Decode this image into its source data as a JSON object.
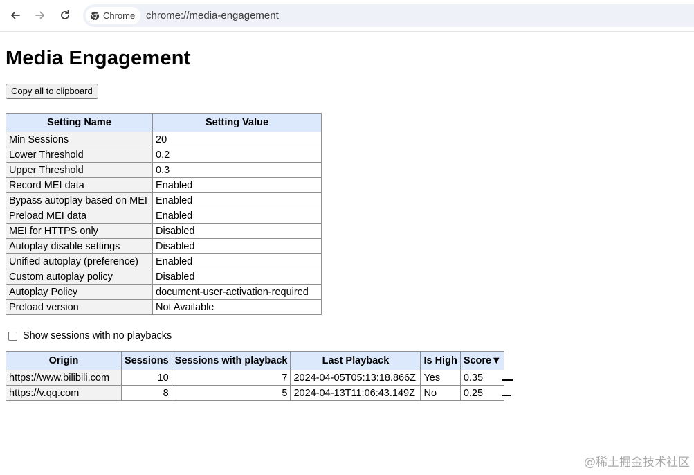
{
  "browser": {
    "chip_label": "Chrome",
    "url": "chrome://media-engagement",
    "icons": [
      "back-icon",
      "forward-icon",
      "reload-icon",
      "chrome-logo-icon"
    ]
  },
  "page": {
    "title": "Media Engagement",
    "copy_button": "Copy all to clipboard"
  },
  "settings_table": {
    "headers": [
      "Setting Name",
      "Setting Value"
    ],
    "rows": [
      {
        "name": "Min Sessions",
        "value": "20"
      },
      {
        "name": "Lower Threshold",
        "value": "0.2"
      },
      {
        "name": "Upper Threshold",
        "value": "0.3"
      },
      {
        "name": "Record MEI data",
        "value": "Enabled"
      },
      {
        "name": "Bypass autoplay based on MEI",
        "value": "Enabled"
      },
      {
        "name": "Preload MEI data",
        "value": "Enabled"
      },
      {
        "name": "MEI for HTTPS only",
        "value": "Disabled"
      },
      {
        "name": "Autoplay disable settings",
        "value": "Disabled"
      },
      {
        "name": "Unified autoplay (preference)",
        "value": "Enabled"
      },
      {
        "name": "Custom autoplay policy",
        "value": "Disabled"
      },
      {
        "name": "Autoplay Policy",
        "value": "document-user-activation-required"
      },
      {
        "name": "Preload version",
        "value": "Not Available"
      }
    ]
  },
  "show_sessions_checkbox": {
    "label": "Show sessions with no playbacks",
    "checked": false
  },
  "sessions_table": {
    "headers": [
      "Origin",
      "Sessions",
      "Sessions with playback",
      "Last Playback",
      "Is High",
      "Score▼"
    ],
    "rows": [
      {
        "origin": "https://www.bilibili.com",
        "sessions": "10",
        "sessions_with_playback": "7",
        "last_playback": "2024-04-05T05:13:18.866Z",
        "is_high": "Yes",
        "score": "0.35",
        "score_bar": 0.35
      },
      {
        "origin": "https://v.qq.com",
        "sessions": "8",
        "sessions_with_playback": "5",
        "last_playback": "2024-04-13T11:06:43.149Z",
        "is_high": "No",
        "score": "0.25",
        "score_bar": 0.25
      }
    ]
  },
  "watermark": "@稀土掘金技术社区"
}
